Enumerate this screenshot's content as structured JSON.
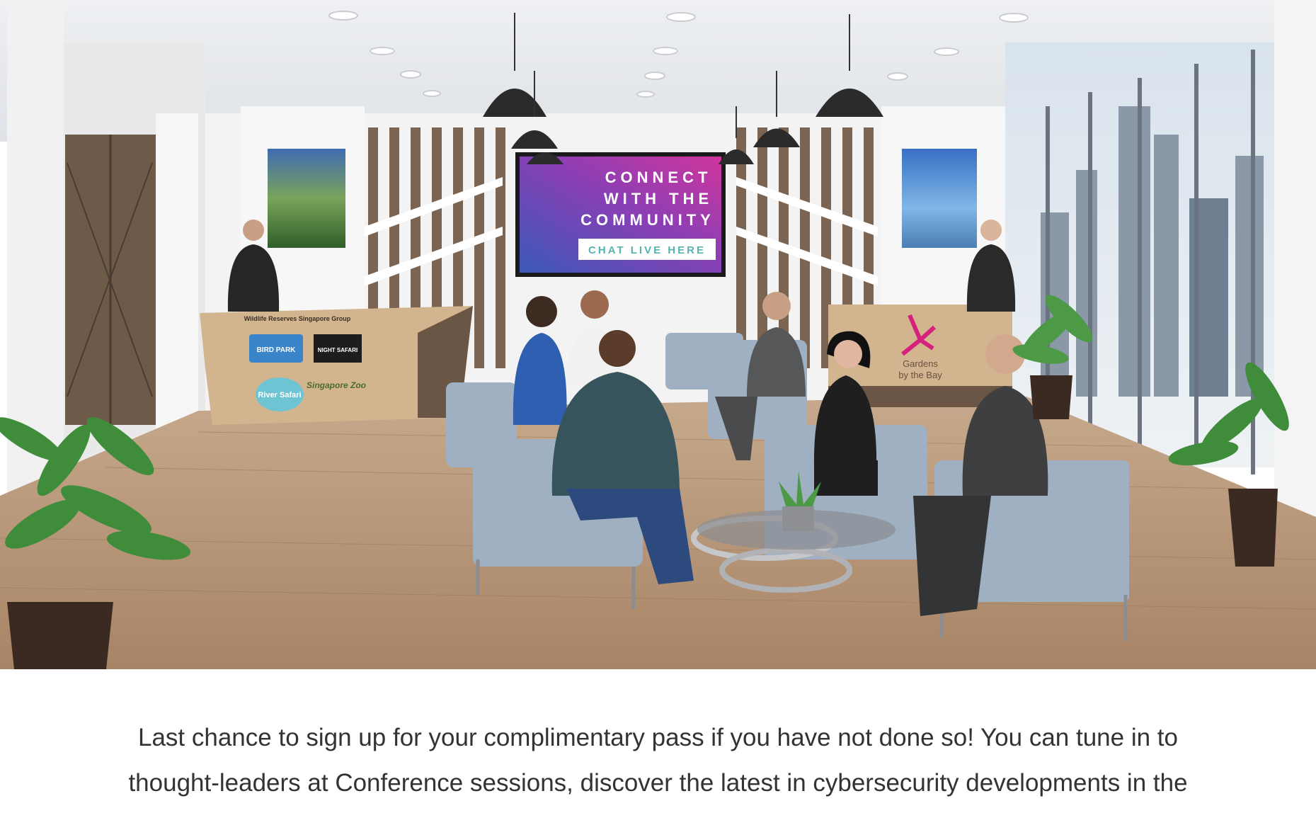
{
  "hero": {
    "screen": {
      "line1": "CONNECT",
      "line2": "WITH THE",
      "line3": "COMMUNITY",
      "button": "CHAT LIVE HERE"
    },
    "left_counter": {
      "header": "Wildlife Reserves Singapore Group",
      "logos": [
        "BIRD PARK",
        "NIGHT SAFARI",
        "River Safari",
        "Singapore Zoo"
      ]
    },
    "right_counter": {
      "logo_line1": "Gardens",
      "logo_line2": "by the Bay"
    },
    "colors": {
      "floor": "#b5957a",
      "chair": "#9fb0c2",
      "screen_start": "#3b59b8",
      "screen_end": "#d0359c",
      "counter": "#d2b48f"
    }
  },
  "caption": {
    "line1": "Last chance to sign up for your complimentary pass if you have not done so! You can tune in to",
    "line2": "thought-leaders at Conference sessions, discover the latest in cybersecurity developments in the"
  }
}
